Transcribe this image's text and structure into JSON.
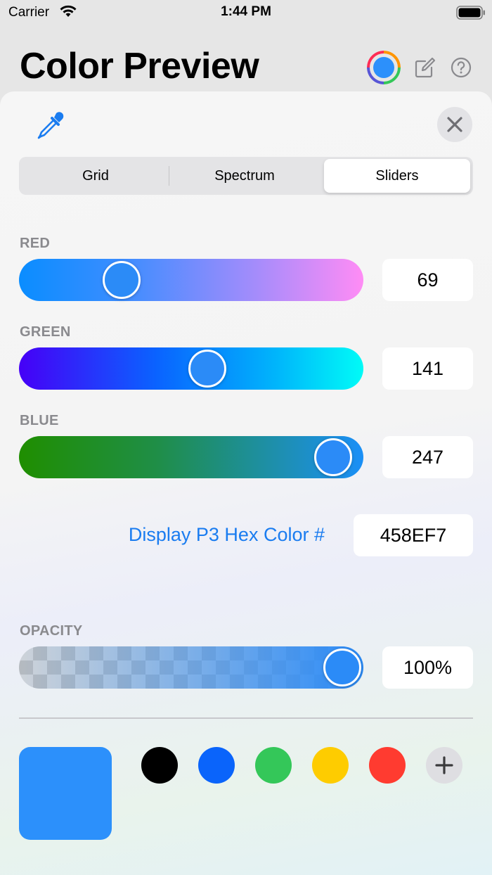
{
  "status_bar": {
    "carrier": "Carrier",
    "time": "1:44 PM"
  },
  "header": {
    "title": "Color Preview",
    "icons": [
      "color-wheel-icon",
      "compose-icon",
      "help-icon"
    ]
  },
  "sheet": {
    "icons": [
      "eyedropper-icon",
      "close-icon"
    ],
    "tabs": [
      {
        "label": "Grid",
        "selected": false
      },
      {
        "label": "Spectrum",
        "selected": false
      },
      {
        "label": "Sliders",
        "selected": true
      }
    ],
    "sliders": {
      "red": {
        "label": "RED",
        "value": "69",
        "level": 69,
        "max": 255
      },
      "green": {
        "label": "GREEN",
        "value": "141",
        "level": 141,
        "max": 255
      },
      "blue": {
        "label": "BLUE",
        "value": "247",
        "level": 247,
        "max": 255
      }
    },
    "hex": {
      "label": "Display P3 Hex Color #",
      "value": "458EF7"
    },
    "opacity": {
      "label": "OPACITY",
      "value": "100%",
      "level": 100
    },
    "current_color": "#2c90fb",
    "presets": [
      "#000000",
      "#0a64fb",
      "#34c759",
      "#fecc00",
      "#ff3b30"
    ],
    "colors": {
      "accent": "#1a7cf0",
      "thumb": "#2b8bf7"
    }
  }
}
